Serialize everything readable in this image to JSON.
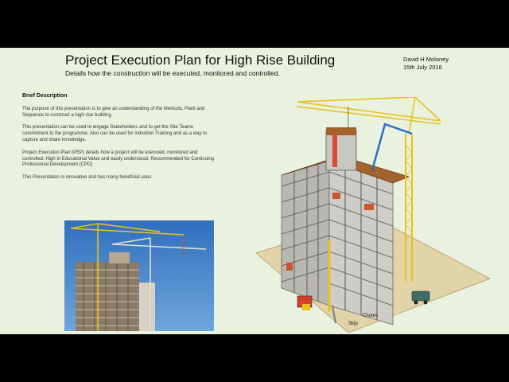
{
  "slide": {
    "title": "Project Execution Plan for High Rise Building",
    "subtitle": "Details how the construction will be executed, monitored and controlled.",
    "author": "David H Moloney",
    "date": "15th July 2016"
  },
  "description": {
    "heading": "Brief Description",
    "paragraphs": [
      "The purpose of this presentation is to give an understanding of the Methods, Plant and Sequence to construct a high-rise building.",
      "This presentation can be used to engage Stakeholders and to get the Site Teams commitment to the programme. Also can be used for Induction Training and as a way to capture and share knowledge.",
      "Project Execution Plan (PEP) details how a project will be executed, monitored and controlled.  High in Educational Value and easily understood. Recommended for Continuing Professional Development (CPD)",
      "This Presentation is innovative and has many beneficial uses."
    ]
  },
  "diagram_labels": {
    "chutes": "Chutes",
    "skip": "Skip"
  },
  "colors": {
    "slide_background": "#e9f1df",
    "letterbox": "#000000",
    "sky": "#3d7fc6",
    "crane_yellow": "#e8c21a"
  }
}
